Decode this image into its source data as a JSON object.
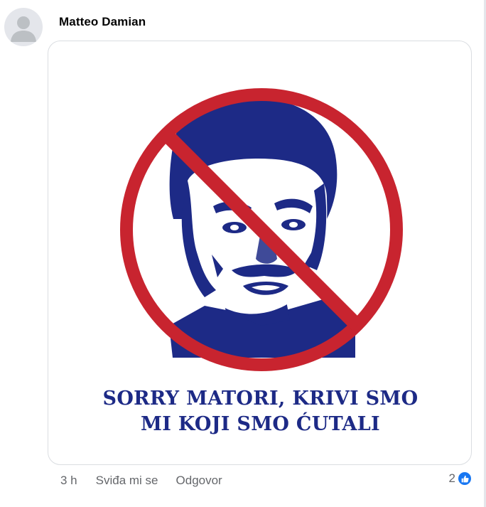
{
  "comment": {
    "author": "Matteo Damian",
    "avatar_icon": "default-avatar-icon",
    "attachment": {
      "poster_line_1": "SORRY MATORI, KRIVI SMO",
      "poster_line_2": "MI KOJI SMO ĆUTALI",
      "prohibition_color": "#c8242f",
      "text_color": "#1d2a86"
    },
    "time": "3 h",
    "like_label": "Sviđa mi se",
    "reply_label": "Odgovor",
    "reaction_count": "2",
    "reaction_icon": "thumbs-up-icon",
    "reaction_color": "#1877f2"
  }
}
